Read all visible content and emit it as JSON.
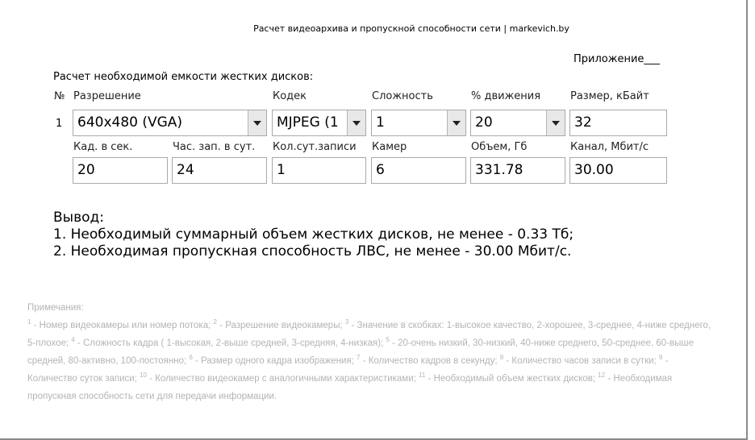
{
  "header": {
    "title": "Расчет видеоархива и пропускной способности сети | markevich.by"
  },
  "appendix": "Приложение___",
  "section_title": "Расчет необходимой емкости жестких дисков:",
  "row1": {
    "labels": [
      "№",
      "Разрешение",
      "Кодек",
      "Сложность",
      "% движения",
      "Размер, кБайт"
    ],
    "number": "1",
    "resolution": "640x480 (VGA)",
    "codec": "MJPEG (1",
    "complexity": "1",
    "motion": "20",
    "frame_size": "32"
  },
  "row2": {
    "labels": [
      "Кад. в сек.",
      "Час. зап. в сут.",
      "Кол.сут.записи",
      "Камер",
      "Объем, Гб",
      "Канал, Мбит/с"
    ],
    "fps": "20",
    "hours": "24",
    "days": "1",
    "cameras": "6",
    "volume": "331.78",
    "channel": "30.00"
  },
  "conclusion": {
    "heading": "Вывод:",
    "line1": "1. Необходимый суммарный объем жестких дисков, не менее - 0.33 Тб;",
    "line2": "2. Необходимая пропускная способность ЛВС, не менее - 30.00 Мбит/с."
  },
  "notes": {
    "heading": "Примечания:",
    "items": [
      {
        "num": "1",
        "text": " - Номер видеокамеры или номер потока; "
      },
      {
        "num": "2",
        "text": " - Разрешение видеокамеры; "
      },
      {
        "num": "3",
        "text": " - Значение в скобках: 1-высокое качество, 2-хорошее, 3-среднее, 4-ниже среднего, 5-плохое; "
      },
      {
        "num": "4",
        "text": " - Сложность кадра ( 1-высокая, 2-выше средней, 3-средняя, 4-низкая); "
      },
      {
        "num": "5",
        "text": " - 20-очень низкий, 30-низкий, 40-ниже среднего, 50-среднее, 60-выше средней, 80-активно, 100-постоянно; "
      },
      {
        "num": "6",
        "text": " - Размер одного кадра изображения; "
      },
      {
        "num": "7",
        "text": " - Количество кадров в секунду; "
      },
      {
        "num": "8",
        "text": " - Количество часов записи в сутки; "
      },
      {
        "num": "9",
        "text": " - Количество суток записи; "
      },
      {
        "num": "10",
        "text": " - Количество видеокамер с аналогичными характеристиками; "
      },
      {
        "num": "11",
        "text": " - Необходимый объем жестких дисков; "
      },
      {
        "num": "12",
        "text": " - Необходимая пропускная способность сети для передачи информации."
      }
    ]
  }
}
